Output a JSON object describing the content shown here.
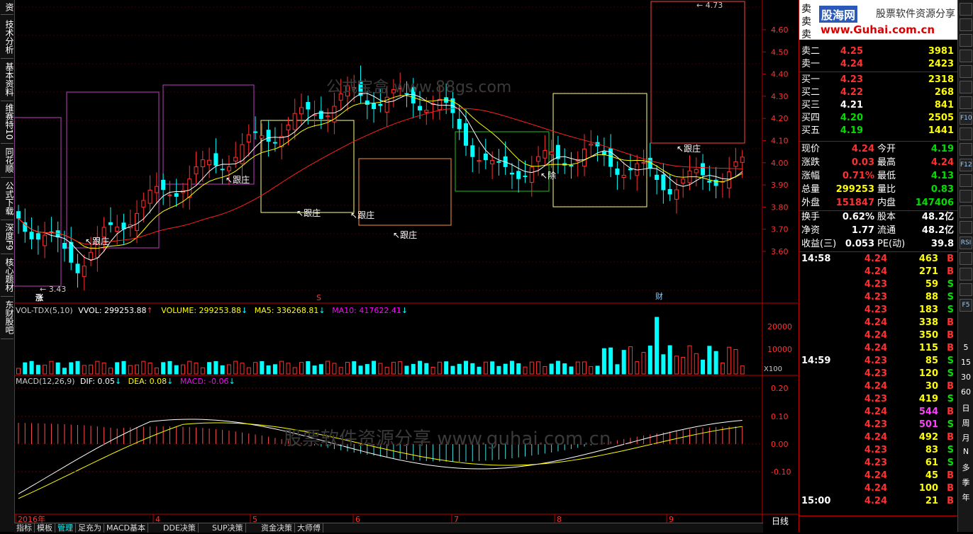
{
  "left_tabs": [
    "技术分析",
    "基本资料",
    "维赛特10",
    "同花顺",
    "公式下载",
    "深度F9",
    "核心题材",
    "东财股吧"
  ],
  "left_top_char": "资",
  "price_axis": [
    "4.60",
    "4.50",
    "4.40",
    "4.30",
    "4.20",
    "4.10",
    "4.00",
    "3.90",
    "3.80",
    "3.70",
    "3.60"
  ],
  "vol_axis": [
    "20000",
    "10000"
  ],
  "vol_unit": "X100",
  "macd_axis": [
    "0.20",
    "0.10",
    "0.00",
    "-0.10"
  ],
  "month_labels": [
    "2016年",
    "4",
    "5",
    "6",
    "7",
    "8",
    "9"
  ],
  "annotations": {
    "high": "4.73",
    "low": "3.43",
    "follow": "跟庄",
    "ex_mark": "除",
    "zhang": "涨",
    "cai": "财",
    "s_mark": "S",
    "watermark1": "公式宝盒 www.88gs.com",
    "watermark2": "股票软件资源分享 www.guhai.com.cn"
  },
  "vol_header": {
    "name": "VOL-TDX(5,10)",
    "vvol": "VVOL: 299253.88",
    "volume": "VOLUME: 299253.88",
    "ma5": "MA5: 336268.81",
    "ma10": "MA10: 417622.41"
  },
  "macd_header": {
    "name": "MACD(12,26,9)",
    "dif": "DIF: 0.05",
    "dea": "DEA: 0.08",
    "macd": "MACD: -0.06"
  },
  "bottom_tabs": [
    "指标",
    "模板",
    "管理",
    "足充为",
    "MACD基本",
    "DDE决策",
    "SUP决策",
    "资金决策",
    "大师傅"
  ],
  "day_label": "日线",
  "logo": {
    "title": "股海网",
    "subtitle": "股票软件资源分享",
    "url": "www.Guhai.com.cn"
  },
  "order_book": [
    {
      "label": "卖二",
      "price": "4.25",
      "vol": "3981",
      "pcolor": "#ff3030"
    },
    {
      "label": "卖一",
      "price": "4.24",
      "vol": "2423",
      "pcolor": "#ff3030"
    },
    {
      "label": "买一",
      "price": "4.23",
      "vol": "2318",
      "pcolor": "#ff3030"
    },
    {
      "label": "买二",
      "price": "4.22",
      "vol": "268",
      "pcolor": "#ff3030"
    },
    {
      "label": "买三",
      "price": "4.21",
      "vol": "841",
      "pcolor": "#ffffff"
    },
    {
      "label": "买四",
      "price": "4.20",
      "vol": "2505",
      "pcolor": "#00e000"
    },
    {
      "label": "买五",
      "price": "4.19",
      "vol": "1441",
      "pcolor": "#00e000"
    }
  ],
  "stats": [
    {
      "l1": "现价",
      "v1": "4.24",
      "c1": "#ff3030",
      "l2": "今开",
      "v2": "4.19",
      "c2": "#00e000"
    },
    {
      "l1": "涨跌",
      "v1": "0.03",
      "c1": "#ff3030",
      "l2": "最高",
      "v2": "4.24",
      "c2": "#ff3030"
    },
    {
      "l1": "涨幅",
      "v1": "0.71%",
      "c1": "#ff3030",
      "l2": "最低",
      "v2": "4.13",
      "c2": "#00e000"
    },
    {
      "l1": "总量",
      "v1": "299253",
      "c1": "#ffff00",
      "l2": "量比",
      "v2": "0.83",
      "c2": "#00e000"
    },
    {
      "l1": "外盘",
      "v1": "151847",
      "c1": "#ff3030",
      "l2": "内盘",
      "v2": "147406",
      "c2": "#00e000"
    },
    {
      "l1": "换手",
      "v1": "0.62%",
      "c1": "#ffffff",
      "l2": "股本",
      "v2": "48.2亿",
      "c2": "#ffffff"
    },
    {
      "l1": "净资",
      "v1": "1.77",
      "c1": "#ffffff",
      "l2": "流通",
      "v2": "48.2亿",
      "c2": "#ffffff"
    },
    {
      "l1": "收益(三)",
      "v1": "0.053",
      "c1": "#ffffff",
      "l2": "PE(动)",
      "v2": "39.8",
      "c2": "#ffffff"
    }
  ],
  "ticks": [
    {
      "time": "14:58",
      "price": "4.24",
      "vol": "463",
      "side": "B"
    },
    {
      "time": "",
      "price": "4.24",
      "vol": "271",
      "side": "B"
    },
    {
      "time": "",
      "price": "4.23",
      "vol": "59",
      "side": "S"
    },
    {
      "time": "",
      "price": "4.23",
      "vol": "88",
      "side": "S"
    },
    {
      "time": "",
      "price": "4.23",
      "vol": "183",
      "side": "S"
    },
    {
      "time": "",
      "price": "4.24",
      "vol": "338",
      "side": "B"
    },
    {
      "time": "",
      "price": "4.24",
      "vol": "350",
      "side": "B"
    },
    {
      "time": "",
      "price": "4.24",
      "vol": "115",
      "side": "B"
    },
    {
      "time": "14:59",
      "price": "4.23",
      "vol": "85",
      "side": "S"
    },
    {
      "time": "",
      "price": "4.23",
      "vol": "120",
      "side": "S"
    },
    {
      "time": "",
      "price": "4.24",
      "vol": "30",
      "side": "B"
    },
    {
      "time": "",
      "price": "4.23",
      "vol": "419",
      "side": "S"
    },
    {
      "time": "",
      "price": "4.24",
      "vol": "544",
      "side": "B"
    },
    {
      "time": "",
      "price": "4.23",
      "vol": "501",
      "side": "S"
    },
    {
      "time": "",
      "price": "4.24",
      "vol": "492",
      "side": "B"
    },
    {
      "time": "",
      "price": "4.23",
      "vol": "83",
      "side": "S"
    },
    {
      "time": "",
      "price": "4.23",
      "vol": "61",
      "side": "S"
    },
    {
      "time": "",
      "price": "4.24",
      "vol": "45",
      "side": "B"
    },
    {
      "time": "",
      "price": "4.24",
      "vol": "100",
      "side": "B"
    },
    {
      "time": "15:00",
      "price": "4.24",
      "vol": "21",
      "side": "B"
    }
  ],
  "right_icons": [
    "",
    "",
    "",
    "",
    "",
    "",
    "",
    "F10",
    "",
    "",
    "F12",
    "",
    "",
    "",
    "",
    "RSI",
    "",
    "",
    "",
    "F5"
  ],
  "right_text": [
    "5",
    "15",
    "30",
    "60",
    "日",
    "周",
    "月",
    "N",
    "多",
    "季",
    "年"
  ],
  "colors": {
    "up": "#ff3030",
    "down": "#00ffff",
    "ma_white": "#ffffff",
    "ma_yellow": "#ffff00",
    "ma_red": "#ff2020"
  }
}
